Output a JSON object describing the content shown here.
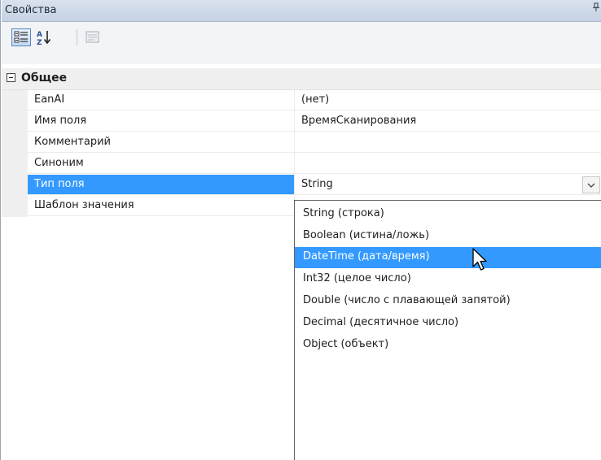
{
  "panel": {
    "title": "Свойства",
    "pin_glyph": "ᵖ"
  },
  "toolbar": {
    "buttons": [
      {
        "icon": "categorized-view-icon",
        "active": true
      },
      {
        "icon": "sort-alphabetical-icon",
        "active": false
      },
      {
        "icon": "property-pages-icon",
        "active": false,
        "disabled": true
      }
    ]
  },
  "grid": {
    "category": {
      "label": "Общее",
      "expanded": true
    },
    "properties": [
      {
        "name": "EanAI",
        "value": "(нет)"
      },
      {
        "name": "Имя поля",
        "value": "ВремяСканирования"
      },
      {
        "name": "Комментарий",
        "value": ""
      },
      {
        "name": "Синоним",
        "value": ""
      },
      {
        "name": "Тип поля",
        "value": "String",
        "selected": true
      },
      {
        "name": "Шаблон значения",
        "value": ""
      }
    ]
  },
  "dropdown": {
    "options": [
      "String (строка)",
      "Boolean (истина/ложь)",
      "DateTime (дата/время)",
      "Int32 (целое число)",
      "Double (число с плавающей запятой)",
      "Decimal (десятичное число)",
      "Object (объект)"
    ],
    "highlighted_index": 2
  },
  "colors": {
    "selection": "#3399ff",
    "title_bar": "#c6d2e3"
  }
}
